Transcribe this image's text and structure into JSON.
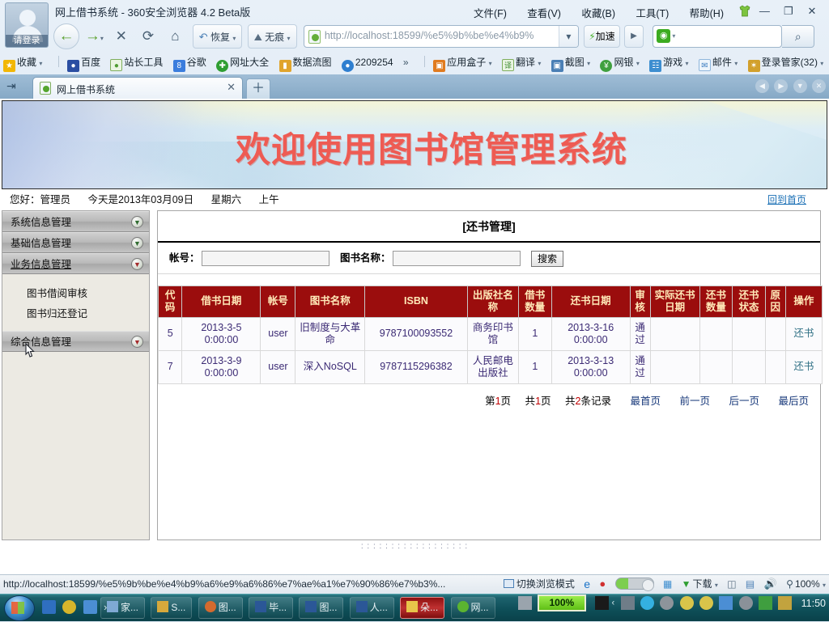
{
  "browser": {
    "window_title": "网上借书系统 - 360安全浏览器 4.2 Beta版",
    "avatar_label": "请登录",
    "menus": [
      {
        "label": "文件(F)"
      },
      {
        "label": "查看(V)"
      },
      {
        "label": "收藏(B)"
      },
      {
        "label": "工具(T)"
      },
      {
        "label": "帮助(H)"
      }
    ],
    "window_controls": {
      "minimize": "—",
      "restore": "❐",
      "close": "✕"
    },
    "nav": {
      "back": "←",
      "forward": "→",
      "forward_caret": "▾",
      "stop": "✕",
      "reload": "⟳",
      "home": "⌂",
      "restore_label": "恢复",
      "restore_caret": "▾",
      "incognito_label": "无痕",
      "incognito_caret": "▾"
    },
    "address": {
      "url": "http://localhost:18599/%e5%9b%be%e4%b9%",
      "dropdown_caret": "▾",
      "accelerate_label": "加速",
      "accelerate_bolt": "⚡",
      "go_caret": "▶"
    },
    "search": {
      "placeholder": "",
      "value": "",
      "engine_glyph": "◉",
      "caret": "▾",
      "go_icon": "⌕"
    },
    "bookmarks": [
      {
        "label": "收藏",
        "icon": "star-icon",
        "color": "#f2b705",
        "glyph": "★",
        "caret": "▾"
      },
      {
        "label": "百度",
        "icon": "baidu-icon",
        "color": "#2b4ea2",
        "glyph": "●"
      },
      {
        "label": "站长工具",
        "icon": "webmaster-tools-icon",
        "color": "#5fae3c",
        "glyph": "●"
      },
      {
        "label": "谷歌",
        "icon": "google-icon",
        "color": "#3b7ddd",
        "glyph": "8"
      },
      {
        "label": "网址大全",
        "icon": "hao360-icon",
        "color": "#2f9e32",
        "glyph": "✚"
      },
      {
        "label": "数据流图",
        "icon": "folder-icon",
        "color": "#e0a42c",
        "glyph": "■"
      },
      {
        "label": "2209254",
        "icon": "qq-icon",
        "color": "#2f7fd0",
        "glyph": "●"
      },
      {
        "label": "»",
        "icon": "overflow-icon",
        "color": "transparent",
        "glyph": ""
      },
      {
        "label": "应用盒子",
        "icon": "appbox-icon",
        "color": "#e07b1f",
        "glyph": "▣",
        "caret": "▾"
      },
      {
        "label": "翻译",
        "icon": "translate-icon",
        "color": "#4b9a3e",
        "glyph": "译",
        "caret": "▾"
      },
      {
        "label": "截图",
        "icon": "screenshot-icon",
        "color": "#4a7fb5",
        "glyph": "▣",
        "caret": "▾"
      },
      {
        "label": "网银",
        "icon": "ebank-icon",
        "color": "#3fa03f",
        "glyph": "¥",
        "caret": "▾"
      },
      {
        "label": "游戏",
        "icon": "games-icon",
        "color": "#3d8ed0",
        "glyph": "☗",
        "caret": "▾"
      },
      {
        "label": "邮件",
        "icon": "mail-icon",
        "color": "#5f9fd4",
        "glyph": "✉",
        "caret": "▾"
      },
      {
        "label": "登录管家(32)",
        "icon": "login-manager-icon",
        "color": "#d2a02c",
        "glyph": "✦",
        "caret": "▾"
      }
    ],
    "tabs": {
      "sidebar_toggle_icon": "panel-toggle-icon",
      "items": [
        {
          "label": "网上借书系统",
          "close": "✕"
        }
      ],
      "new_tab": "＋",
      "nav_buttons": [
        "◀",
        "▶",
        "▼",
        "✕"
      ]
    }
  },
  "page": {
    "banner_title": "欢迎使用图书馆管理系统",
    "greeting": {
      "user": "您好：管理员",
      "date": "今天是2013年03月09日",
      "weekday": "星期六",
      "period": "上午"
    },
    "home_link": "回到首页",
    "sidebar": {
      "groups": [
        {
          "label": "系统信息管理",
          "expanded": false,
          "knob": "▼",
          "items": []
        },
        {
          "label": "基础信息管理",
          "expanded": false,
          "knob": "▼",
          "items": []
        },
        {
          "label": "业务信息管理",
          "expanded": true,
          "knob": "▼",
          "items": [
            "图书借阅审核",
            "图书归还登记"
          ]
        },
        {
          "label": "综合信息管理",
          "expanded": false,
          "knob": "▼",
          "items": []
        }
      ]
    },
    "content": {
      "title": "[还书管理]",
      "search": {
        "account_label": "帐号：",
        "account_value": "",
        "book_label": "图书名称：",
        "book_value": "",
        "button": "搜索"
      },
      "table": {
        "headers": [
          "代码",
          "借书日期",
          "帐号",
          "图书名称",
          "ISBN",
          "出版社名称",
          "借书数量",
          "还书日期",
          "审核",
          "实际还书日期",
          "还书数量",
          "还书状态",
          "原因",
          "操作"
        ],
        "rows": [
          {
            "code": "5",
            "borrow_date": "2013-3-5 0:00:00",
            "account": "user",
            "book_name": "旧制度与大革命",
            "isbn": "9787100093552",
            "publisher": "商务印书馆",
            "borrow_qty": "1",
            "return_date": "2013-3-16 0:00:00",
            "audit": "通过",
            "actual_return_date": "",
            "return_qty": "",
            "return_status": "",
            "reason": "",
            "action": "还书"
          },
          {
            "code": "7",
            "borrow_date": "2013-3-9 0:00:00",
            "account": "user",
            "book_name": "深入NoSQL",
            "isbn": "9787115296382",
            "publisher": "人民邮电出版社",
            "borrow_qty": "1",
            "return_date": "2013-3-13 0:00:00",
            "audit": "通过",
            "actual_return_date": "",
            "return_qty": "",
            "return_status": "",
            "reason": "",
            "action": "还书"
          }
        ]
      },
      "pager": {
        "current_prefix": "第",
        "current_num": "1",
        "current_suffix": "页",
        "total_prefix": "共",
        "total_num": "1",
        "total_suffix": "页",
        "records_prefix": "共",
        "records_num": "2",
        "records_suffix": "条记录",
        "first": "最首页",
        "prev": "前一页",
        "next": "后一页",
        "last": "最后页"
      }
    }
  },
  "statusbar": {
    "url": "http://localhost:18599/%e5%9b%be%e4%b9%a6%e9%a6%86%e7%ae%a1%e7%90%86%e7%b3%...",
    "browse_mode": "切换浏览模式",
    "download_label": "下载",
    "zoom": "100%",
    "zoom_caret": "▾"
  },
  "taskbar": {
    "start_label": "start",
    "quick_launch": [
      {
        "name": "show-desktop-icon",
        "color": "#2f6fc0"
      },
      {
        "name": "360-safe-icon",
        "color": "#d7b52b"
      },
      {
        "name": "media-icon",
        "color": "#4b8ed4"
      },
      {
        "name": "more-icon",
        "color": "transparent",
        "glyph": "›"
      }
    ],
    "tasks": [
      {
        "label": "家...",
        "icon": "explorer-icon",
        "color": "#7fa9d4",
        "active": false
      },
      {
        "label": "S...",
        "icon": "tool-icon",
        "color": "#d6a93c",
        "active": false
      },
      {
        "label": "图...",
        "icon": "app-icon",
        "color": "#d46a2e",
        "active": false
      },
      {
        "label": "毕...",
        "icon": "word-icon",
        "color": "#2b5797",
        "active": false
      },
      {
        "label": "图...",
        "icon": "word-icon",
        "color": "#2b5797",
        "active": false
      },
      {
        "label": "人...",
        "icon": "word-icon",
        "color": "#2b5797",
        "active": false
      },
      {
        "label": "朵...",
        "icon": "note-icon",
        "color": "#e8c44a",
        "active": true
      },
      {
        "label": "网...",
        "icon": "browser-icon",
        "color": "#5bb430",
        "active": false
      }
    ],
    "battery": "100%",
    "clock": "11:50"
  }
}
